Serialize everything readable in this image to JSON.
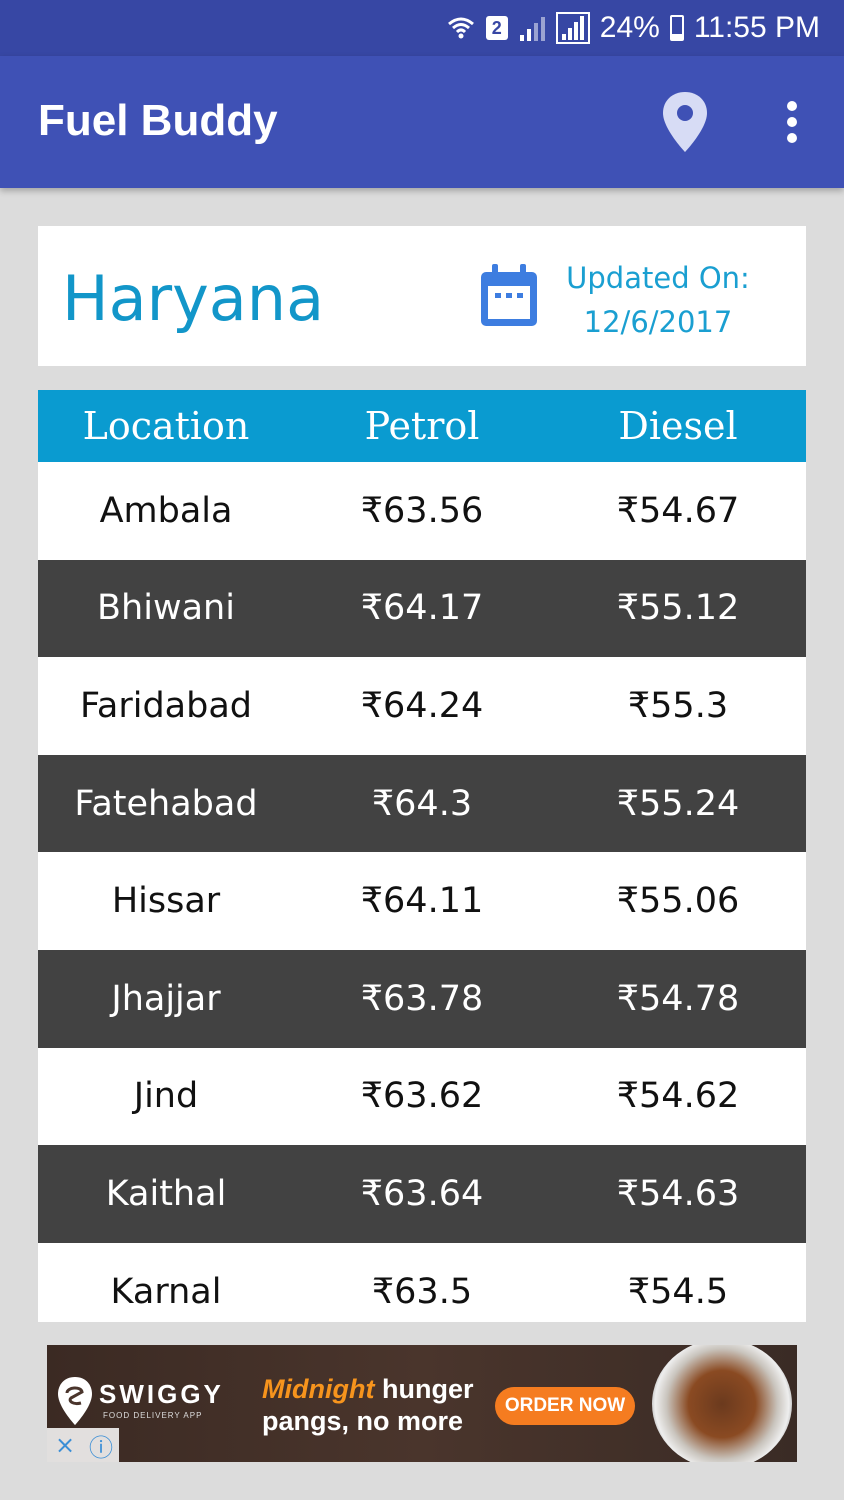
{
  "status_bar": {
    "sim": "2",
    "battery": "24%",
    "battery_level": 0.24,
    "time": "11:55 PM",
    "icons": [
      "wifi-icon",
      "sim-badge-icon",
      "signal-icon",
      "signal-icon",
      "battery-icon"
    ]
  },
  "app_bar": {
    "title": "Fuel Buddy",
    "actions": [
      "location-pin-icon",
      "more-vert-icon"
    ]
  },
  "header": {
    "state": "Haryana",
    "updated_label": "Updated On:",
    "updated_date": "12/6/2017",
    "icon": "calendar-icon"
  },
  "table": {
    "columns": [
      "Location",
      "Petrol",
      "Diesel"
    ],
    "rows": [
      {
        "location": "Ambala",
        "petrol": "₹63.56",
        "diesel": "₹54.67"
      },
      {
        "location": "Bhiwani",
        "petrol": "₹64.17",
        "diesel": "₹55.12"
      },
      {
        "location": "Faridabad",
        "petrol": "₹64.24",
        "diesel": "₹55.3"
      },
      {
        "location": "Fatehabad",
        "petrol": "₹64.3",
        "diesel": "₹55.24"
      },
      {
        "location": "Hissar",
        "petrol": "₹64.11",
        "diesel": "₹55.06"
      },
      {
        "location": "Jhajjar",
        "petrol": "₹63.78",
        "diesel": "₹54.78"
      },
      {
        "location": "Jind",
        "petrol": "₹63.62",
        "diesel": "₹54.62"
      },
      {
        "location": "Kaithal",
        "petrol": "₹63.64",
        "diesel": "₹54.63"
      },
      {
        "location": "Karnal",
        "petrol": "₹63.5",
        "diesel": "₹54.5"
      }
    ]
  },
  "ad": {
    "brand": "SWIGGY",
    "brand_sub": "FOOD DELIVERY APP",
    "headline_highlight": "Midnight",
    "headline_rest": "hunger",
    "headline_line2": "pangs, no more",
    "cta": "ORDER NOW",
    "close_icon": "×",
    "info_icon": "ⓘ"
  },
  "colors": {
    "status_bar": "#3747a4",
    "app_bar": "#3f51b5",
    "accent": "#0a9bd0",
    "row_dark": "#424242",
    "background": "#dcdcdc"
  }
}
